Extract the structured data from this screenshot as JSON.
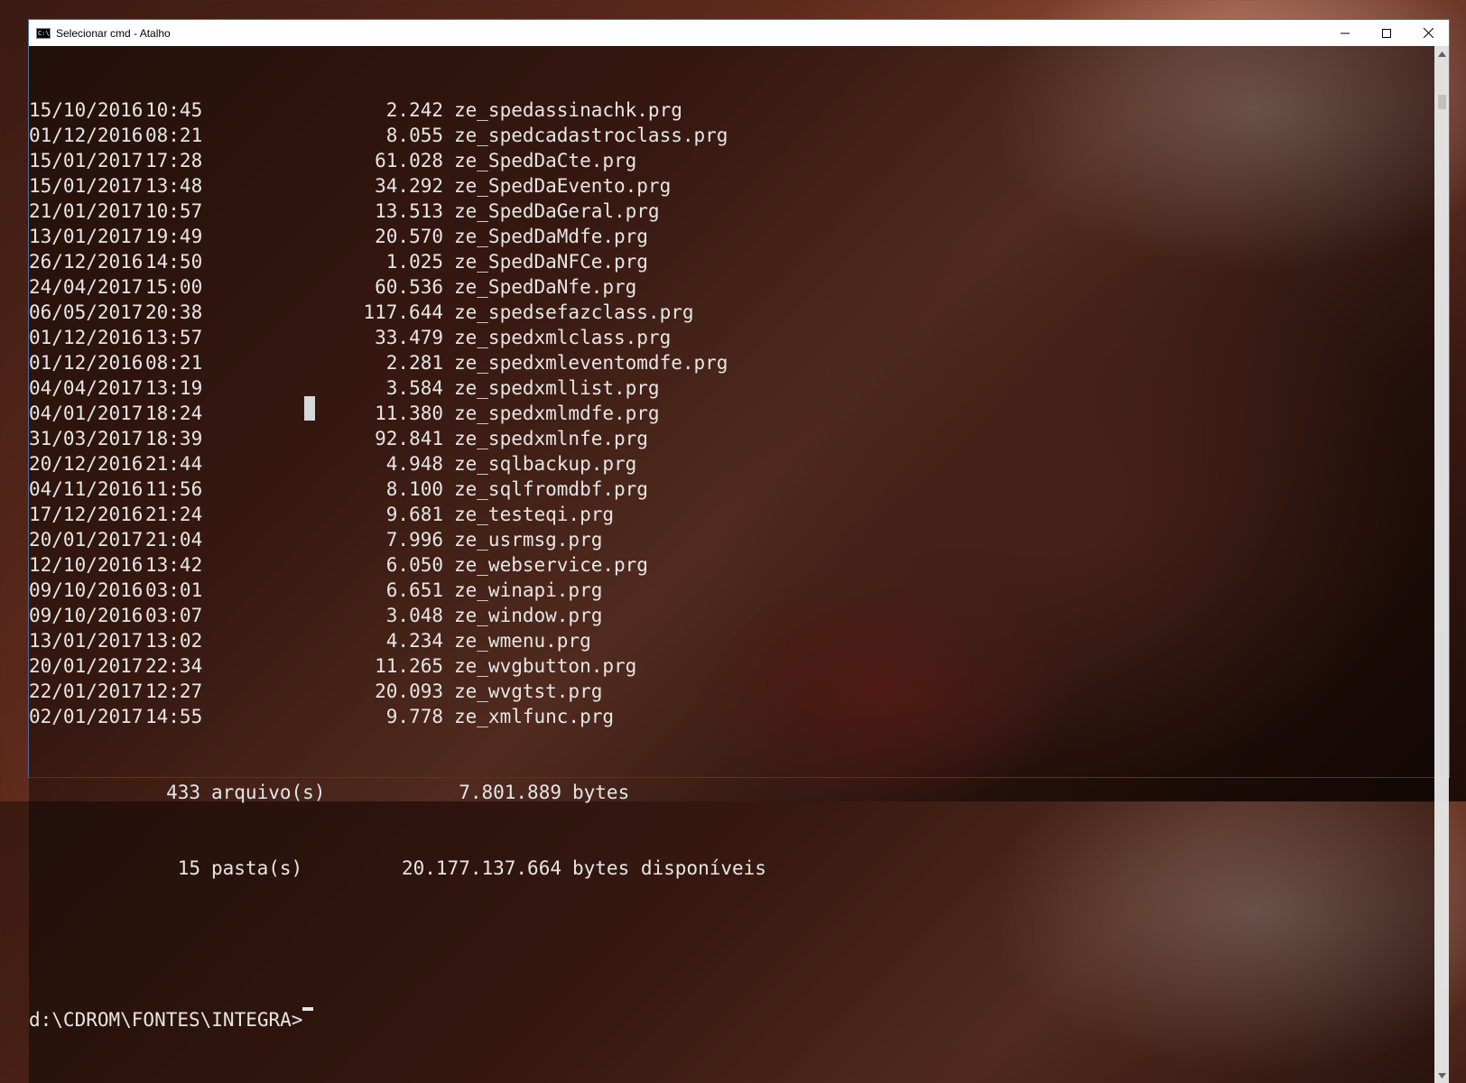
{
  "window": {
    "title": "Selecionar cmd - Atalho",
    "minimize_label": "—",
    "maximize_label": "☐",
    "close_label": "✕"
  },
  "listing": [
    {
      "date": "15/10/2016",
      "time": "10:45",
      "size": "2.242",
      "name": "ze_spedassinachk.prg"
    },
    {
      "date": "01/12/2016",
      "time": "08:21",
      "size": "8.055",
      "name": "ze_spedcadastroclass.prg"
    },
    {
      "date": "15/01/2017",
      "time": "17:28",
      "size": "61.028",
      "name": "ze_SpedDaCte.prg"
    },
    {
      "date": "15/01/2017",
      "time": "13:48",
      "size": "34.292",
      "name": "ze_SpedDaEvento.prg"
    },
    {
      "date": "21/01/2017",
      "time": "10:57",
      "size": "13.513",
      "name": "ze_SpedDaGeral.prg"
    },
    {
      "date": "13/01/2017",
      "time": "19:49",
      "size": "20.570",
      "name": "ze_SpedDaMdfe.prg"
    },
    {
      "date": "26/12/2016",
      "time": "14:50",
      "size": "1.025",
      "name": "ze_SpedDaNFCe.prg"
    },
    {
      "date": "24/04/2017",
      "time": "15:00",
      "size": "60.536",
      "name": "ze_SpedDaNfe.prg"
    },
    {
      "date": "06/05/2017",
      "time": "20:38",
      "size": "117.644",
      "name": "ze_spedsefazclass.prg"
    },
    {
      "date": "01/12/2016",
      "time": "13:57",
      "size": "33.479",
      "name": "ze_spedxmlclass.prg"
    },
    {
      "date": "01/12/2016",
      "time": "08:21",
      "size": "2.281",
      "name": "ze_spedxmleventomdfe.prg"
    },
    {
      "date": "04/04/2017",
      "time": "13:19",
      "size": "3.584",
      "name": "ze_spedxmllist.prg"
    },
    {
      "date": "04/01/2017",
      "time": "18:24",
      "size": "11.380",
      "name": "ze_spedxmlmdfe.prg"
    },
    {
      "date": "31/03/2017",
      "time": "18:39",
      "size": "92.841",
      "name": "ze_spedxmlnfe.prg"
    },
    {
      "date": "20/12/2016",
      "time": "21:44",
      "size": "4.948",
      "name": "ze_sqlbackup.prg"
    },
    {
      "date": "04/11/2016",
      "time": "11:56",
      "size": "8.100",
      "name": "ze_sqlfromdbf.prg"
    },
    {
      "date": "17/12/2016",
      "time": "21:24",
      "size": "9.681",
      "name": "ze_testeqi.prg"
    },
    {
      "date": "20/01/2017",
      "time": "21:04",
      "size": "7.996",
      "name": "ze_usrmsg.prg"
    },
    {
      "date": "12/10/2016",
      "time": "13:42",
      "size": "6.050",
      "name": "ze_webservice.prg"
    },
    {
      "date": "09/10/2016",
      "time": "03:01",
      "size": "6.651",
      "name": "ze_winapi.prg"
    },
    {
      "date": "09/10/2016",
      "time": "03:07",
      "size": "3.048",
      "name": "ze_window.prg"
    },
    {
      "date": "13/01/2017",
      "time": "13:02",
      "size": "4.234",
      "name": "ze_wmenu.prg"
    },
    {
      "date": "20/01/2017",
      "time": "22:34",
      "size": "11.265",
      "name": "ze_wvgbutton.prg"
    },
    {
      "date": "22/01/2017",
      "time": "12:27",
      "size": "20.093",
      "name": "ze_wvgtst.prg"
    },
    {
      "date": "02/01/2017",
      "time": "14:55",
      "size": "9.778",
      "name": "ze_xmlfunc.prg"
    }
  ],
  "summary": {
    "files_count": "433",
    "files_label": "arquivo(s)",
    "files_bytes": "7.801.889",
    "files_unit": "bytes",
    "dirs_count": "15",
    "dirs_label": "pasta(s)",
    "dirs_bytes": "20.177.137.664",
    "dirs_unit": "bytes disponíveis"
  },
  "prompt": "d:\\CDROM\\FONTES\\INTEGRA>"
}
